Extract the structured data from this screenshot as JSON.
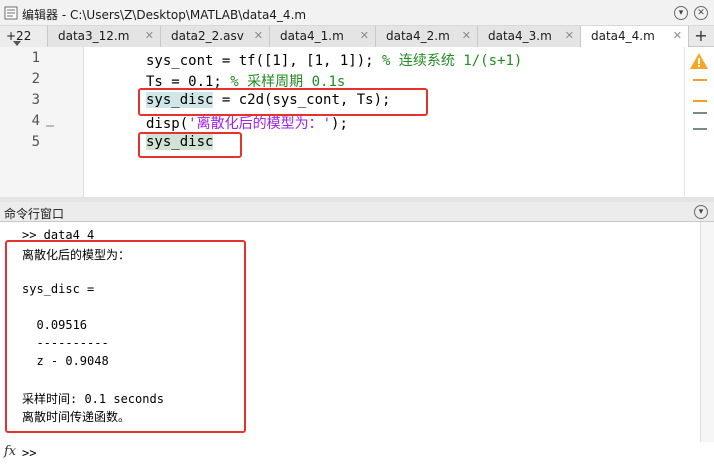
{
  "window": {
    "title": "编辑器 - C:\\Users\\Z\\Desktop\\MATLAB\\data4_4.m"
  },
  "tabs": {
    "overflow_count": "+22",
    "items": [
      {
        "label": "data3_12.m"
      },
      {
        "label": "data2_2.asv"
      },
      {
        "label": "data4_1.m"
      },
      {
        "label": "data4_2.m"
      },
      {
        "label": "data4_3.m"
      },
      {
        "label": "data4_4.m"
      }
    ],
    "active": "data4_4.m",
    "close_glyph": "✕",
    "add_glyph": "+"
  },
  "editor": {
    "line_numbers": [
      "1",
      "2",
      "3",
      "4",
      "5"
    ],
    "line1": {
      "code": "sys_cont = tf([1], [1, 1]); ",
      "comment": "% 连续系统 1/(s+1)"
    },
    "line2": {
      "code": "Ts = 0.1; ",
      "comment": "% 采样周期 0.1s"
    },
    "line3": {
      "var": "sys_disc",
      "rest": " = c2d(sys_cont, Ts);"
    },
    "line4": {
      "prefix": "disp(",
      "string": "'离散化后的模型为：'",
      "suffix": ");"
    },
    "line5": {
      "var": "sys_disc"
    },
    "rail_icons": [
      "warning-icon"
    ]
  },
  "command_window": {
    "title": "命令行窗口",
    "lines": [
      ">> data4_4",
      "离散化后的模型为：",
      "",
      "sys_disc =",
      "",
      "  0.09516",
      "  ----------",
      "  z - 0.9048",
      "",
      "采样时间: 0.1 seconds",
      "离散时间传递函数。"
    ],
    "prompt": ">>",
    "fx_label": "fx"
  },
  "colors": {
    "highlight_box": "#e5322d",
    "comment": "#228b22",
    "string": "#a020f0",
    "warning": "#f5a623"
  }
}
